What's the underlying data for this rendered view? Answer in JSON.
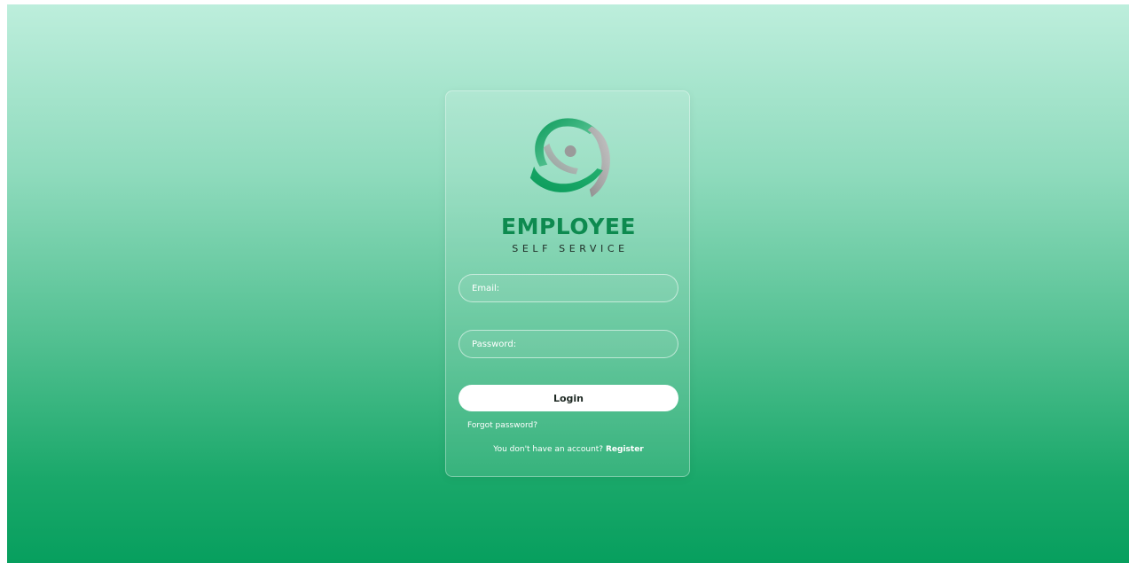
{
  "brand": {
    "title": "EMPLOYEE",
    "subtitle": "SELF SERVICE",
    "logo_icon": "orbit-logo-icon",
    "title_color": "#0d8a4f"
  },
  "form": {
    "email_placeholder": "Email:",
    "password_placeholder": "Password:",
    "login_label": "Login",
    "forgot_label": "Forgot password?",
    "register_prompt": "You don't have an account?",
    "register_label": "Register"
  },
  "colors": {
    "background_top": "#bdeedc",
    "background_bottom": "#079f5e",
    "accent": "#079f5e"
  }
}
